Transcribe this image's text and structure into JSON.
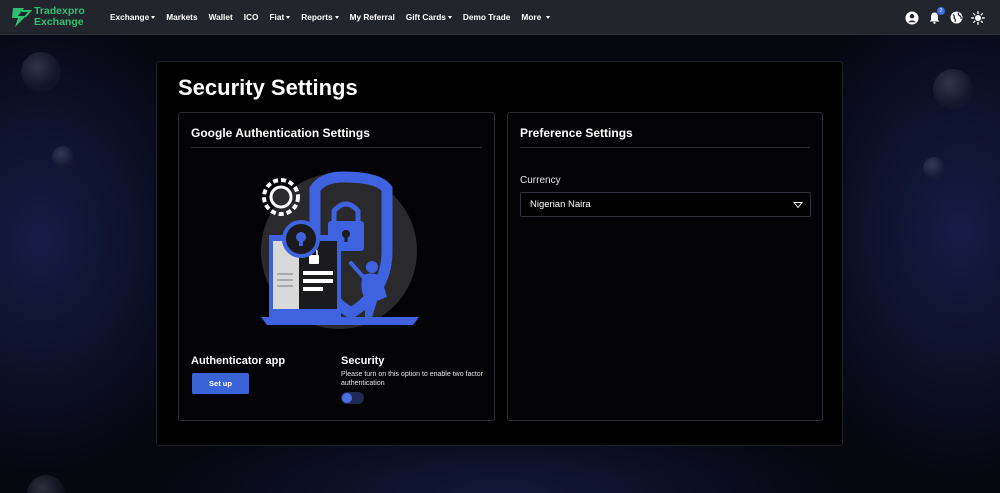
{
  "brand": {
    "name_line1": "Tradexpro",
    "name_line2": "Exchange",
    "color": "#2fbf71"
  },
  "nav": {
    "items": [
      {
        "label": "Exchange",
        "dropdown": true
      },
      {
        "label": "Markets",
        "dropdown": false
      },
      {
        "label": "Wallet",
        "dropdown": false
      },
      {
        "label": "ICO",
        "dropdown": false
      },
      {
        "label": "Fiat",
        "dropdown": true
      },
      {
        "label": "Reports",
        "dropdown": true
      },
      {
        "label": "My Referral",
        "dropdown": false
      },
      {
        "label": "Gift Cards",
        "dropdown": true
      },
      {
        "label": "Demo Trade",
        "dropdown": false
      },
      {
        "label": "More",
        "dropdown": true
      }
    ],
    "icons": [
      "user-icon",
      "bell-icon",
      "globe-icon",
      "sun-icon"
    ],
    "notification_count": "2"
  },
  "page": {
    "title": "Security Settings"
  },
  "google_auth": {
    "title": "Google Authentication Settings",
    "authenticator_label": "Authenticator app",
    "setup_button": "Set up",
    "security_label": "Security",
    "security_description": "Please turn on this option to enable two factor authentication",
    "two_factor_enabled": false
  },
  "preferences": {
    "title": "Preference Settings",
    "currency_label": "Currency",
    "currency_value": "Nigerian Naira"
  },
  "colors": {
    "accent": "#3b63d8",
    "background": "#000000",
    "nav_bg": "#22252b"
  }
}
